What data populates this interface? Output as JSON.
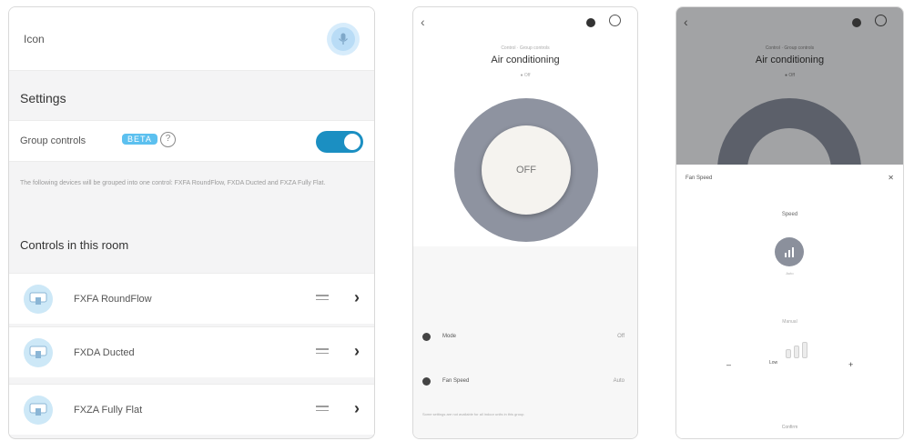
{
  "panel1": {
    "icon_label": "Icon",
    "settings_title": "Settings",
    "group_controls_label": "Group controls",
    "beta_badge": "BETA",
    "help_icon": "?",
    "group_controls_enabled": true,
    "info_text": "The following devices will be grouped into one control: FXFA RoundFlow, FXDA Ducted and FXZA Fully Flat.",
    "controls_title": "Controls in this room",
    "controls": [
      {
        "name": "FXFA RoundFlow"
      },
      {
        "name": "FXDA Ducted"
      },
      {
        "name": "FXZA Fully Flat"
      }
    ],
    "icons": {
      "mic": "microphone-icon",
      "unit": "ac-unit-icon",
      "drag": "drag-handle-icon",
      "chevron": "chevron-right-icon"
    },
    "colors": {
      "toggle_on": "#1b8fc2",
      "beta": "#5cc0ef",
      "unit_bg": "#cde8f7"
    }
  },
  "panel2": {
    "back": "‹",
    "subtitle": "Control · Group controls",
    "title": "Air conditioning",
    "status_sub": "● Off",
    "power_state": "OFF",
    "rows": [
      {
        "label": "Mode",
        "value": "Off"
      },
      {
        "label": "Fan Speed",
        "value": "Auto"
      }
    ],
    "note": "Some settings are not available for all indoor units in this group."
  },
  "panel3": {
    "back": "‹",
    "subtitle": "Control · Group controls",
    "title": "Air conditioning",
    "status_sub": "● Off",
    "sheet_title": "Fan Speed",
    "sheet_close": "✕",
    "speed_label": "Speed",
    "fan_sub": "Auto",
    "mid_label": "Manual",
    "minus": "–",
    "plus": "+",
    "bar_label": "Low",
    "bottom_label": "Confirm"
  }
}
